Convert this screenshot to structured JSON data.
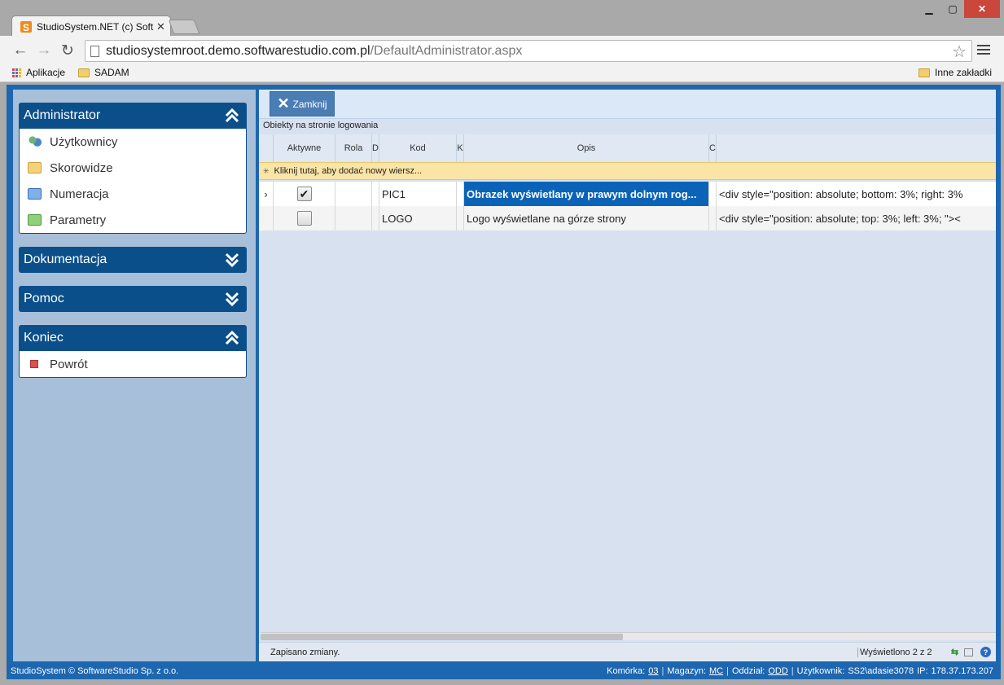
{
  "browser": {
    "tab_title": "StudioSystem.NET (c) Soft",
    "url_host": "studiosystemroot.demo.softwarestudio.com.pl",
    "url_path": "/DefaultAdministrator.aspx",
    "bookmarks": {
      "apps": "Aplikacje",
      "sadam": "SADAM",
      "other": "Inne zakładki"
    }
  },
  "sidebar": {
    "admin": {
      "title": "Administrator",
      "items": [
        {
          "label": "Użytkownicy",
          "icon": "users-icon"
        },
        {
          "label": "Skorowidze",
          "icon": "folder-icon"
        },
        {
          "label": "Numeracja",
          "icon": "folder-icon"
        },
        {
          "label": "Parametry",
          "icon": "folder-icon"
        }
      ]
    },
    "docs": {
      "title": "Dokumentacja"
    },
    "help": {
      "title": "Pomoc"
    },
    "end": {
      "title": "Koniec",
      "items": [
        {
          "label": "Powrót",
          "icon": "exit-icon"
        }
      ]
    }
  },
  "toolbar": {
    "close_label": "Zamknij"
  },
  "grid": {
    "caption": "Obiekty na stronie logowania",
    "headers": {
      "aktywne": "Aktywne",
      "rola": "Rola",
      "d": "D",
      "kod": "Kod",
      "k": "K",
      "opis": "Opis",
      "c": "C"
    },
    "new_row": "Kliknij tutaj, aby dodać nowy wiersz...",
    "rows": [
      {
        "active": true,
        "kod": "PIC1",
        "opis": "Obrazek wyświetlany w prawym dolnym rog...",
        "content": "<div style=\"position: absolute; bottom: 3%; right: 3%"
      },
      {
        "active": false,
        "kod": "LOGO",
        "opis": "Logo wyświetlane na górze strony",
        "content": "<div style=\"position: absolute; top: 3%; left: 3%; \"><"
      }
    ],
    "status": "Zapisano zmiany.",
    "count": "Wyświetlono 2 z 2"
  },
  "statusbar": {
    "copyright": "StudioSystem © SoftwareStudio Sp. z o.o.",
    "komorka_label": "Komórka:",
    "komorka_value": "03",
    "magazyn_label": "Magazyn:",
    "magazyn_value": "MC",
    "oddzial_label": "Oddział:",
    "oddzial_value": "ODD",
    "user_label": "Użytkownik:",
    "user_value": "SS2\\adasie3078",
    "ip_label": "IP:",
    "ip_value": "178.37.173.207"
  }
}
